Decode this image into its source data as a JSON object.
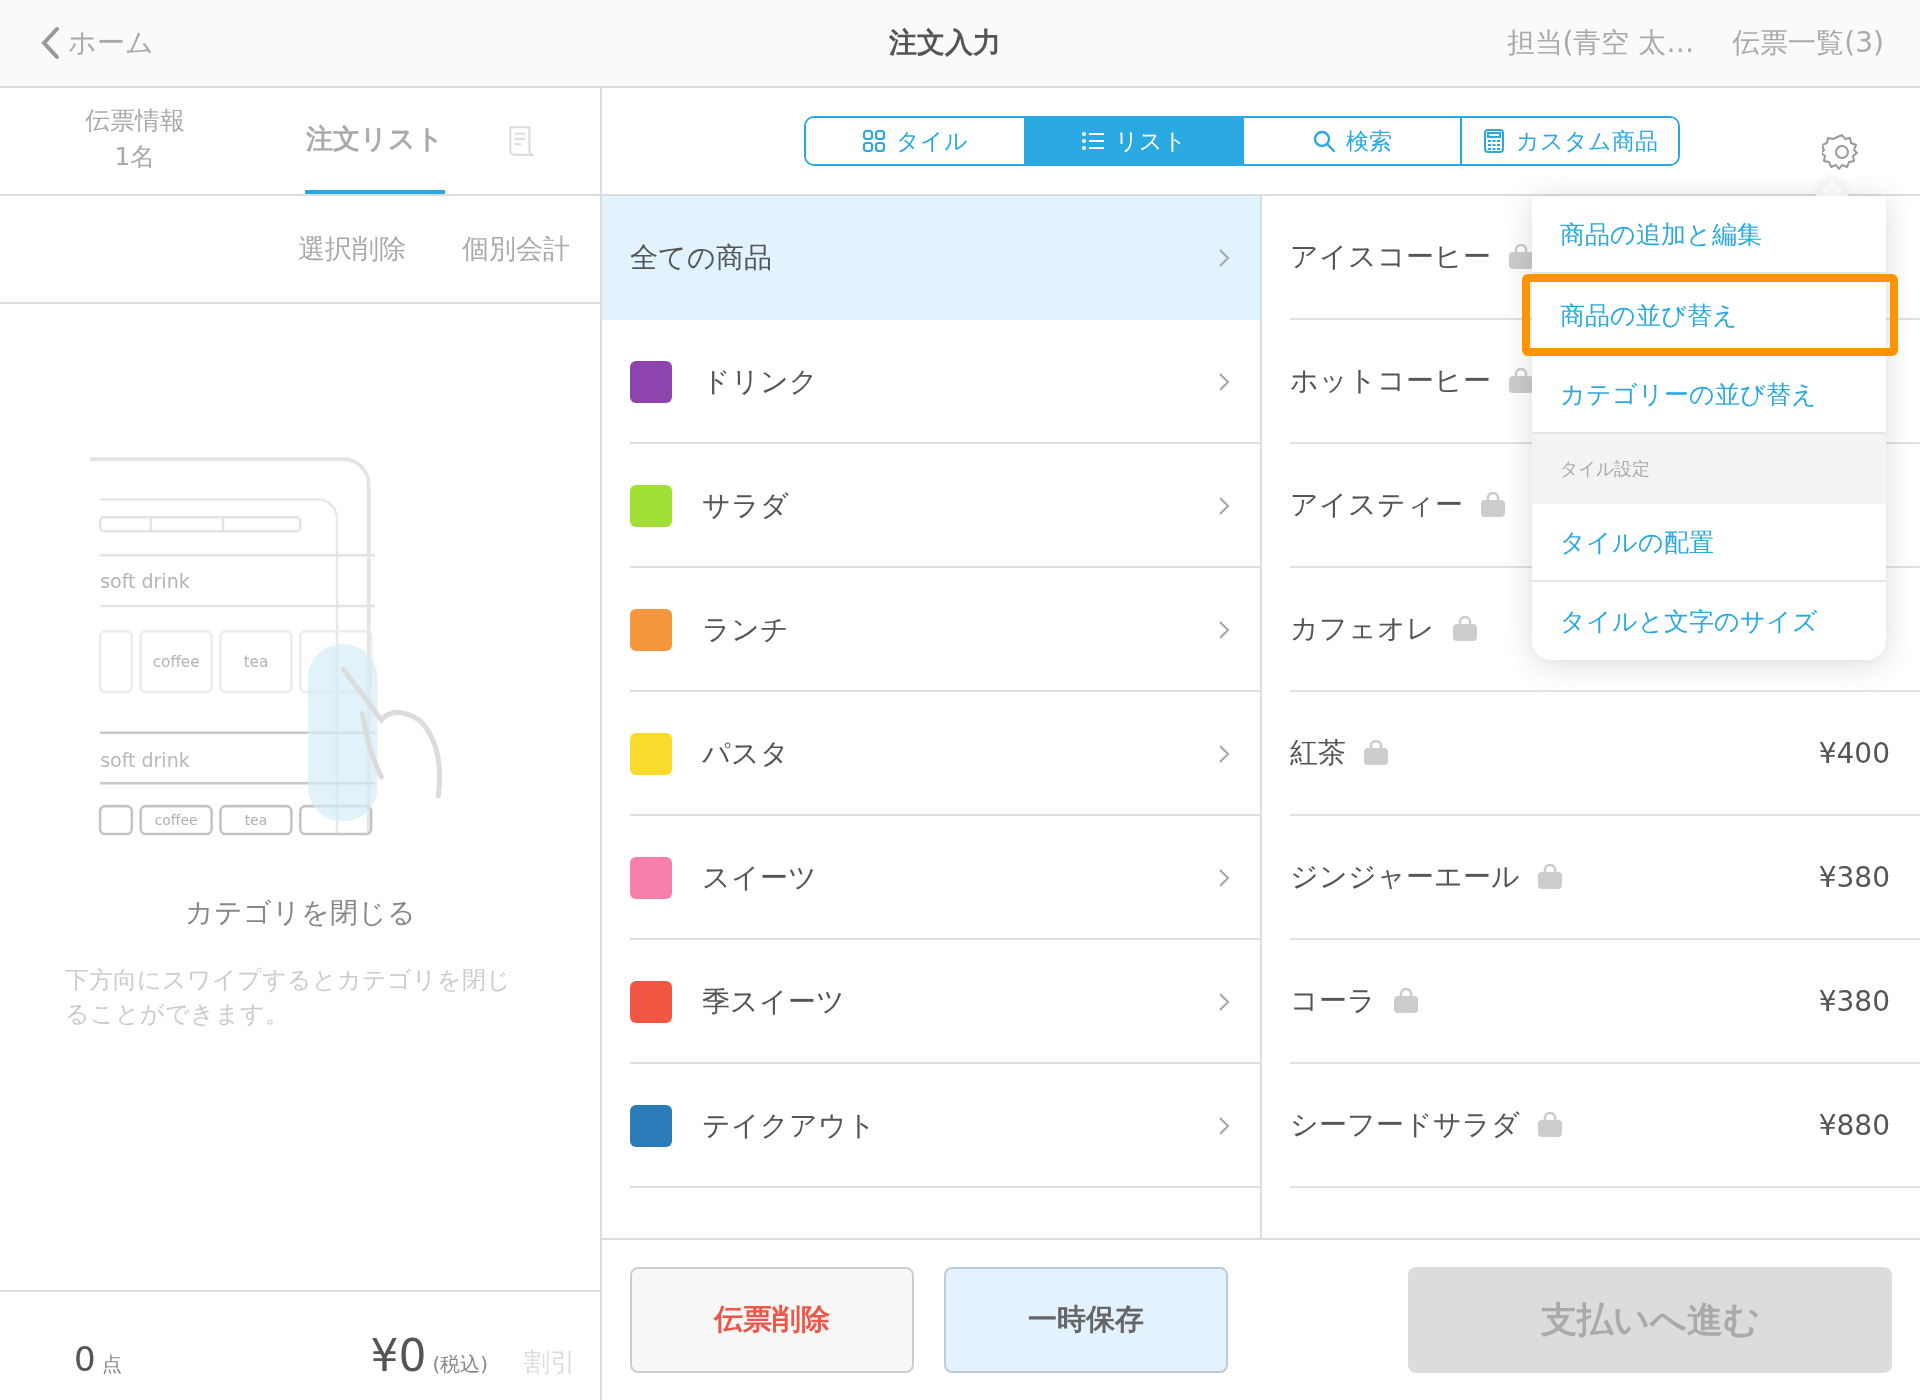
{
  "header": {
    "back": "ホーム",
    "title": "注文入力",
    "staff": "担当(青空 太…",
    "slips": "伝票一覧(3)"
  },
  "left_tabs": [
    {
      "label": "伝票情報",
      "sub": "1名",
      "selected": false
    },
    {
      "label": "注文リスト",
      "selected": true
    }
  ],
  "left_actions": [
    "選択削除",
    "個別会計"
  ],
  "illustration": {
    "labels": [
      "soft drink",
      "coffee",
      "tea",
      "soft drink",
      "coffee",
      "tea"
    ]
  },
  "hint": {
    "title": "カテゴリを閉じる",
    "text": "下方向にスワイプするとカテゴリを閉じることができます。"
  },
  "totals": {
    "count": "0",
    "count_unit": "点",
    "amount": "¥0",
    "tax": "(税込)",
    "discount": "割引"
  },
  "view_tabs": [
    {
      "label": "タイル",
      "selected": false
    },
    {
      "label": "リスト",
      "selected": true
    },
    {
      "label": "検索",
      "selected": false
    },
    {
      "label": "カスタム商品",
      "selected": false
    }
  ],
  "categories": [
    {
      "name": "全ての商品",
      "selected": true
    },
    {
      "name": "ドリンク",
      "color": "#8e44ad",
      "selected": false
    },
    {
      "name": "サラダ",
      "color": "#a3e035",
      "selected": false
    },
    {
      "name": "ランチ",
      "color": "#f5973f",
      "selected": false
    },
    {
      "name": "パスタ",
      "color": "#f9dc2b",
      "selected": false
    },
    {
      "name": "スイーツ",
      "color": "#f87fac",
      "selected": false
    },
    {
      "name": "季スイーツ",
      "color": "#f15744",
      "selected": false
    },
    {
      "name": "テイクアウト",
      "color": "#2a7bb8",
      "selected": false
    }
  ],
  "products": [
    {
      "name": "アイスコーヒー"
    },
    {
      "name": "ホットコーヒー"
    },
    {
      "name": "アイスティー"
    },
    {
      "name": "カフェオレ"
    },
    {
      "name": "紅茶",
      "price": "¥400"
    },
    {
      "name": "ジンジャーエール",
      "price": "¥380"
    },
    {
      "name": "コーラ",
      "price": "¥380"
    },
    {
      "name": "シーフードサラダ",
      "price": "¥880"
    }
  ],
  "settings_menu": [
    {
      "kind": "item",
      "label": "商品の追加と編集",
      "highlighted": false
    },
    {
      "kind": "item",
      "label": "商品の並び替え",
      "highlighted": true
    },
    {
      "kind": "item",
      "label": "カテゴリーの並び替え",
      "highlighted": false
    },
    {
      "kind": "section",
      "label": "タイル設定"
    },
    {
      "kind": "item",
      "label": "タイルの配置",
      "highlighted": false
    },
    {
      "kind": "item",
      "label": "タイルと文字のサイズ",
      "highlighted": false
    }
  ],
  "actions": {
    "delete": "伝票削除",
    "hold": "一時保存",
    "pay": "支払いへ進む",
    "pay_disabled": true
  }
}
